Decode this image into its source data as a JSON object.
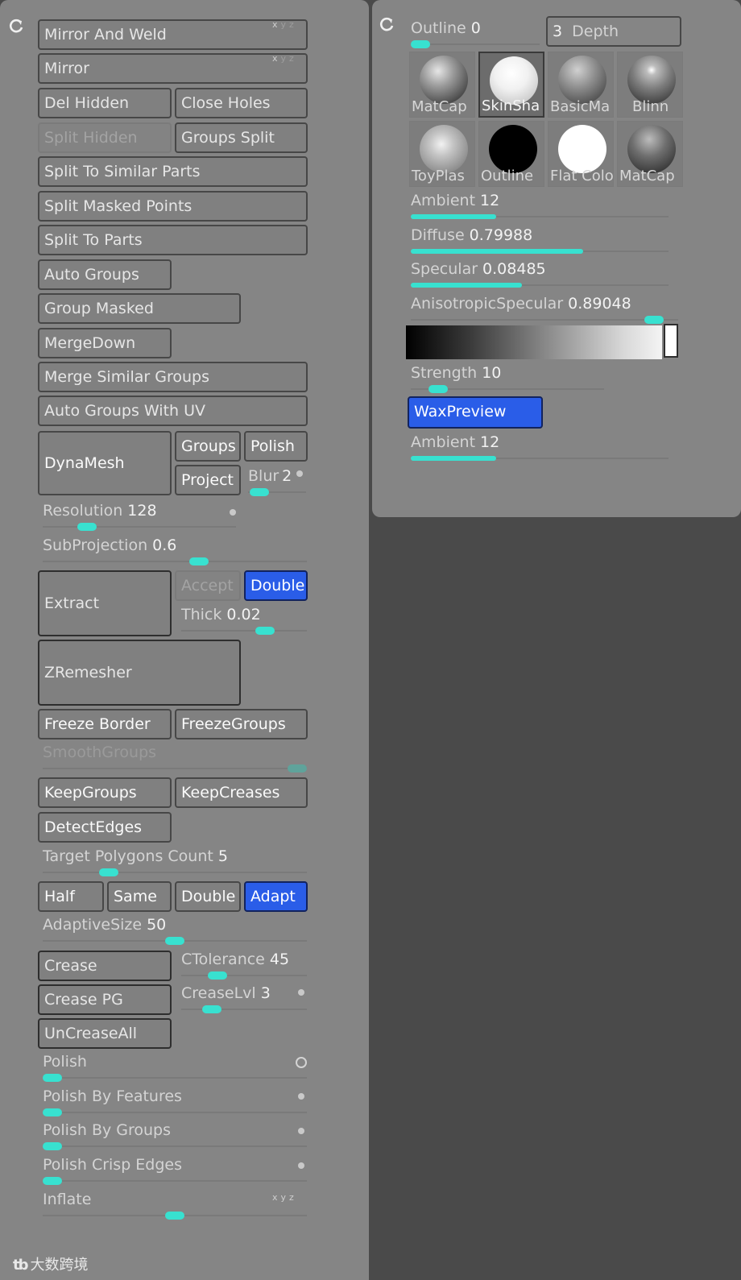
{
  "left_buttons": {
    "mirror_and_weld": "Mirror And Weld",
    "mirror": "Mirror",
    "del_hidden": "Del Hidden",
    "close_holes": "Close Holes",
    "split_hidden": "Split Hidden",
    "groups_split": "Groups Split",
    "split_to_similar_parts": "Split To Similar Parts",
    "split_masked_points": "Split Masked Points",
    "split_to_parts": "Split To Parts",
    "auto_groups": "Auto Groups",
    "group_masked": "Group Masked",
    "merge_down": "MergeDown",
    "merge_similar_groups": "Merge Similar Groups",
    "auto_groups_with_uv": "Auto Groups With UV",
    "dynamesh": "DynaMesh",
    "groups": "Groups",
    "polish": "Polish",
    "project": "Project",
    "extract": "Extract",
    "accept": "Accept",
    "double_extract": "Double",
    "zremesher": "ZRemesher",
    "freeze_border": "Freeze Border",
    "freeze_groups": "FreezeGroups",
    "keep_groups": "KeepGroups",
    "keep_creases": "KeepCreases",
    "detect_edges": "DetectEdges",
    "half": "Half",
    "same": "Same",
    "double_target": "Double",
    "adapt": "Adapt",
    "crease": "Crease",
    "crease_pg": "Crease PG",
    "uncrease_all": "UnCreaseAll"
  },
  "left_sliders": {
    "blur": {
      "label": "Blur",
      "value": "2",
      "level": 0.05
    },
    "resolution": {
      "label": "Resolution",
      "value": "128",
      "level": 0.2
    },
    "subprojection": {
      "label": "SubProjection",
      "value": "0.6",
      "level": 0.6
    },
    "thick": {
      "label": "Thick",
      "value": "0.02",
      "level": 0.7
    },
    "smooth_groups": {
      "label": "SmoothGroups",
      "value": "",
      "level": 1.0
    },
    "target_polygons_count": {
      "label": "Target Polygons Count",
      "value": "5",
      "level": 0.23
    },
    "adaptive_size": {
      "label": "AdaptiveSize",
      "value": "50",
      "level": 0.5
    },
    "ctolerance": {
      "label": "CTolerance",
      "value": "45",
      "level": 0.25
    },
    "crease_lvl": {
      "label": "CreaseLvl",
      "value": "3",
      "level": 0.2
    },
    "polish": {
      "label": "Polish",
      "value": "",
      "level": 0.0
    },
    "polish_by_features": {
      "label": "Polish By Features",
      "value": "",
      "level": 0.0
    },
    "polish_by_groups": {
      "label": "Polish By Groups",
      "value": "",
      "level": 0.0
    },
    "polish_crisp_edges": {
      "label": "Polish Crisp Edges",
      "value": "",
      "level": 0.0
    },
    "inflate": {
      "label": "Inflate",
      "value": "",
      "level": 0.5
    }
  },
  "axis_toggles": {
    "x": "x",
    "y": "y",
    "z": "z"
  },
  "right_panel": {
    "outline": {
      "label": "Outline",
      "value": "0",
      "level": 0.0
    },
    "depth": {
      "value": "3",
      "label": "Depth",
      "level": 0.4
    },
    "materials": [
      {
        "label": "MatCap",
        "icon": "matcap-gray-sphere"
      },
      {
        "label": "SkinSha",
        "icon": "skinshade-white-sphere"
      },
      {
        "label": "BasicMa",
        "icon": "basic-material-sphere"
      },
      {
        "label": "Blinn",
        "icon": "blinn-sphere"
      },
      {
        "label": "ToyPlas",
        "icon": "toyplastic-sphere"
      },
      {
        "label": "Outline",
        "icon": "outline-black-sphere"
      },
      {
        "label": "Flat Colo",
        "icon": "flat-color-white-sphere"
      },
      {
        "label": "MatCap",
        "icon": "matcap-dark-sphere"
      }
    ],
    "ambient": {
      "label": "Ambient",
      "value": "12",
      "level": 0.33
    },
    "diffuse": {
      "label": "Diffuse",
      "value": "0.79988",
      "level": 0.67
    },
    "specular": {
      "label": "Specular",
      "value": "0.08485",
      "level": 0.43
    },
    "anisotropic_specular": {
      "label": "AnisotropicSpecular",
      "value": "0.89048",
      "level": 0.94
    },
    "strength": {
      "label": "Strength",
      "value": "10",
      "level": 0.1
    },
    "wax_preview": "WaxPreview",
    "ambient2": {
      "label": "Ambient",
      "value": "12",
      "level": 0.33
    }
  },
  "watermark": {
    "logo": "tb",
    "text": "大数跨境"
  },
  "colors": {
    "accent": "#38e1d0",
    "active_button": "#2a5de8",
    "panel": "#858585",
    "background": "#4a4a4a"
  }
}
